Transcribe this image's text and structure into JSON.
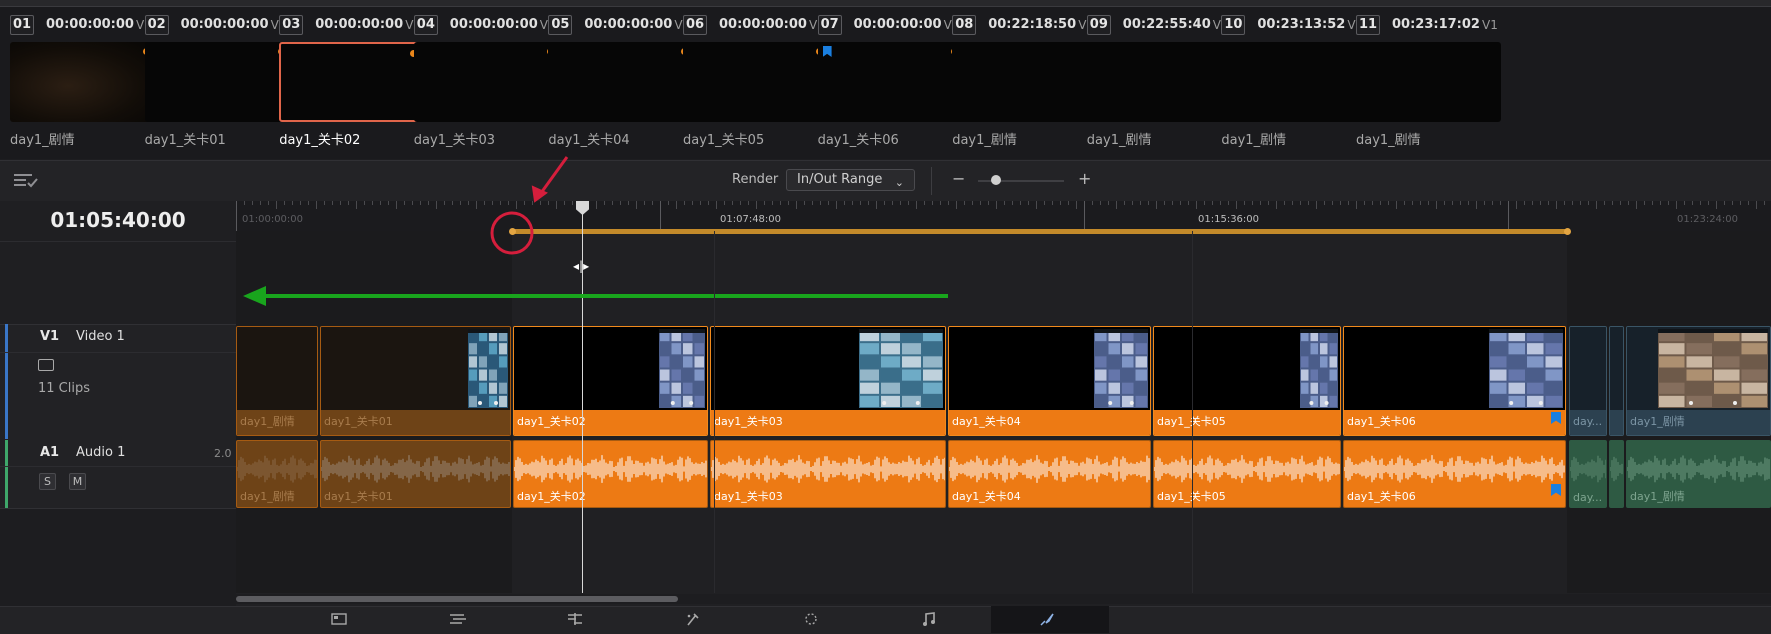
{
  "clips": [
    {
      "num": "01",
      "timecode": "00:00:00:00",
      "track": "V1",
      "name": "day1_剧情",
      "dot": true,
      "marker": false,
      "selected": false
    },
    {
      "num": "02",
      "timecode": "00:00:00:00",
      "track": "V1",
      "name": "day1_关卡01",
      "dot": true,
      "marker": false,
      "selected": false
    },
    {
      "num": "03",
      "timecode": "00:00:00:00",
      "track": "V1",
      "name": "day1_关卡02",
      "dot": true,
      "marker": false,
      "selected": true
    },
    {
      "num": "04",
      "timecode": "00:00:00:00",
      "track": "V1",
      "name": "day1_关卡03",
      "dot": true,
      "marker": false,
      "selected": false
    },
    {
      "num": "05",
      "timecode": "00:00:00:00",
      "track": "V1",
      "name": "day1_关卡04",
      "dot": true,
      "marker": false,
      "selected": false
    },
    {
      "num": "06",
      "timecode": "00:00:00:00",
      "track": "V1",
      "name": "day1_关卡05",
      "dot": true,
      "marker": false,
      "selected": false
    },
    {
      "num": "07",
      "timecode": "00:00:00:00",
      "track": "V1",
      "name": "day1_关卡06",
      "dot": true,
      "marker": true,
      "selected": false
    },
    {
      "num": "08",
      "timecode": "00:22:18:50",
      "track": "V1",
      "name": "day1_剧情",
      "dot": false,
      "marker": false,
      "selected": false
    },
    {
      "num": "09",
      "timecode": "00:22:55:40",
      "track": "V1",
      "name": "day1_剧情",
      "dot": false,
      "marker": false,
      "selected": false
    },
    {
      "num": "10",
      "timecode": "00:23:13:52",
      "track": "V1",
      "name": "day1_剧情",
      "dot": false,
      "marker": false,
      "selected": false
    },
    {
      "num": "11",
      "timecode": "00:23:17:02",
      "track": "V1",
      "name": "day1_剧情",
      "dot": false,
      "marker": false,
      "selected": false
    }
  ],
  "toolbar": {
    "render_label": "Render",
    "render_range": "In/Out Range",
    "zoom_minus": "−",
    "zoom_plus": "+",
    "zoom_level": 0.2
  },
  "timeline": {
    "current_timecode": "01:05:40:00",
    "ruler_labels": [
      "01:00:00:00",
      "01:07:48:00",
      "01:15:36:00",
      "01:23:24:00"
    ]
  },
  "tracks": {
    "video": {
      "id": "V1",
      "name": "Video 1",
      "clip_count": "11 Clips"
    },
    "audio": {
      "id": "A1",
      "name": "Audio 1",
      "level": "2.0",
      "solo": "S",
      "mute": "M"
    }
  },
  "timeline_clips": {
    "video": [
      "day1_剧情",
      "day1_关卡01",
      "day1_关卡02",
      "day1_关卡03",
      "day1_关卡04",
      "day1_关卡05",
      "day1_关卡06",
      "day...",
      "day1_剧情"
    ],
    "audio": [
      "day1_剧情",
      "day1_关卡01",
      "day1_关卡02",
      "day1_关卡03",
      "day1_关卡04",
      "day1_关卡05",
      "day1_关卡06",
      "day...",
      "day1_剧情"
    ]
  },
  "pages": [
    "media",
    "cut",
    "edit",
    "fusion",
    "color",
    "fairlight",
    "deliver"
  ],
  "active_page": "deliver",
  "colors": {
    "clip_orange": "#ed7a14",
    "selected_border": "#e0654a",
    "marker_blue": "#1a7fe0",
    "inout_bar": "#c38a2a",
    "annotation_red": "#d51e3c",
    "annotation_green": "#19a51d"
  }
}
